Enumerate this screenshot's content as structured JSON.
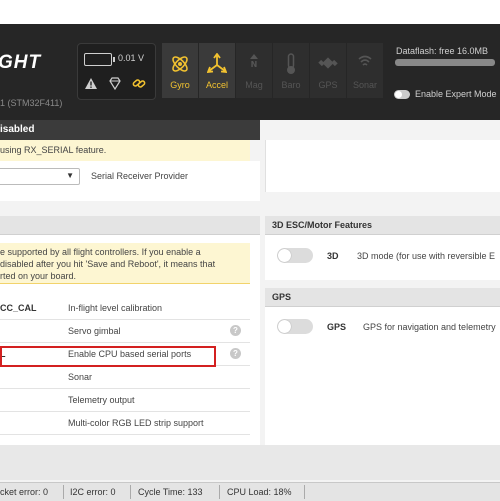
{
  "header": {
    "logo_text": "GHT",
    "mcu": "1 (STM32F411)",
    "voltage": "0.01 V",
    "sensors": [
      {
        "label": "Gyro",
        "active": true,
        "icon": "gyro-icon"
      },
      {
        "label": "Accel",
        "active": true,
        "icon": "accel-icon"
      },
      {
        "label": "Mag",
        "active": false,
        "icon": "mag-icon"
      },
      {
        "label": "Baro",
        "active": false,
        "icon": "baro-icon"
      },
      {
        "label": "GPS",
        "active": false,
        "icon": "gps-icon"
      },
      {
        "label": "Sonar",
        "active": false,
        "icon": "sonar-icon"
      }
    ],
    "dataflash": "Dataflash: free 16.0MB",
    "expert_mode_label": "Enable Expert Mode"
  },
  "receiver": {
    "disabled_bar": "isabled",
    "note": "using RX_SERIAL feature.",
    "provider_label": "Serial Receiver Provider",
    "dropdown_arrow": "▼"
  },
  "features": {
    "note_lines": [
      "e supported by all flight controllers. If you enable a",
      "disabled after you hit 'Save and Reboot', it means that",
      "rted on your board."
    ],
    "rows": [
      {
        "name": "CC_CAL",
        "desc": "In-flight level calibration",
        "help": false
      },
      {
        "name": "",
        "desc": "Servo gimbal",
        "help": true
      },
      {
        "name": "L",
        "desc": "Enable CPU based serial ports",
        "help": true
      },
      {
        "name": "",
        "desc": "Sonar",
        "help": false
      },
      {
        "name": "",
        "desc": "Telemetry output",
        "help": false
      },
      {
        "name": "",
        "desc": "Multi-color RGB LED strip support",
        "help": false
      }
    ]
  },
  "esc": {
    "title": "3D ESC/Motor Features",
    "name": "3D",
    "desc": "3D mode (for use with reversible E"
  },
  "gps": {
    "title": "GPS",
    "name": "GPS",
    "desc": "GPS for navigation and telemetry"
  },
  "status_bar": {
    "packet_error": "cket error: 0",
    "i2c_error": "I2C error: 0",
    "cycle_time": "Cycle Time: 133",
    "cpu_load": "CPU Load: 18%"
  }
}
